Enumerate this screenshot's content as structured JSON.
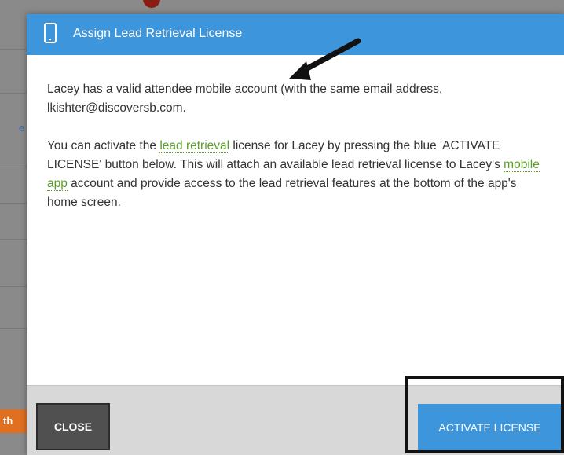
{
  "background": {
    "orange_button_label": "th"
  },
  "modal": {
    "title": "Assign Lead Retrieval License",
    "icon": "mobile-phone-icon",
    "paragraph1": "Lacey has a valid attendee mobile account (with the same email address, lkishter@discoversb.com.",
    "paragraph2_part1": "You can activate the ",
    "paragraph2_link1": "lead retrieval",
    "paragraph2_part2": " license for Lacey by pressing the blue 'ACTIVATE LICENSE' button below. This will attach an available lead retrieval license to Lacey's ",
    "paragraph2_link2": "mobile app",
    "paragraph2_part3": " account and provide access to the lead retrieval features at the bottom of the app's home screen.",
    "close_label": "CLOSE",
    "activate_label": "ACTIVATE LICENSE"
  },
  "colors": {
    "header_blue": "#3d95dc",
    "link_green": "#5a9e2a",
    "close_dark": "#505050",
    "footer_gray": "#d8d8d8",
    "orange": "#e07020"
  }
}
